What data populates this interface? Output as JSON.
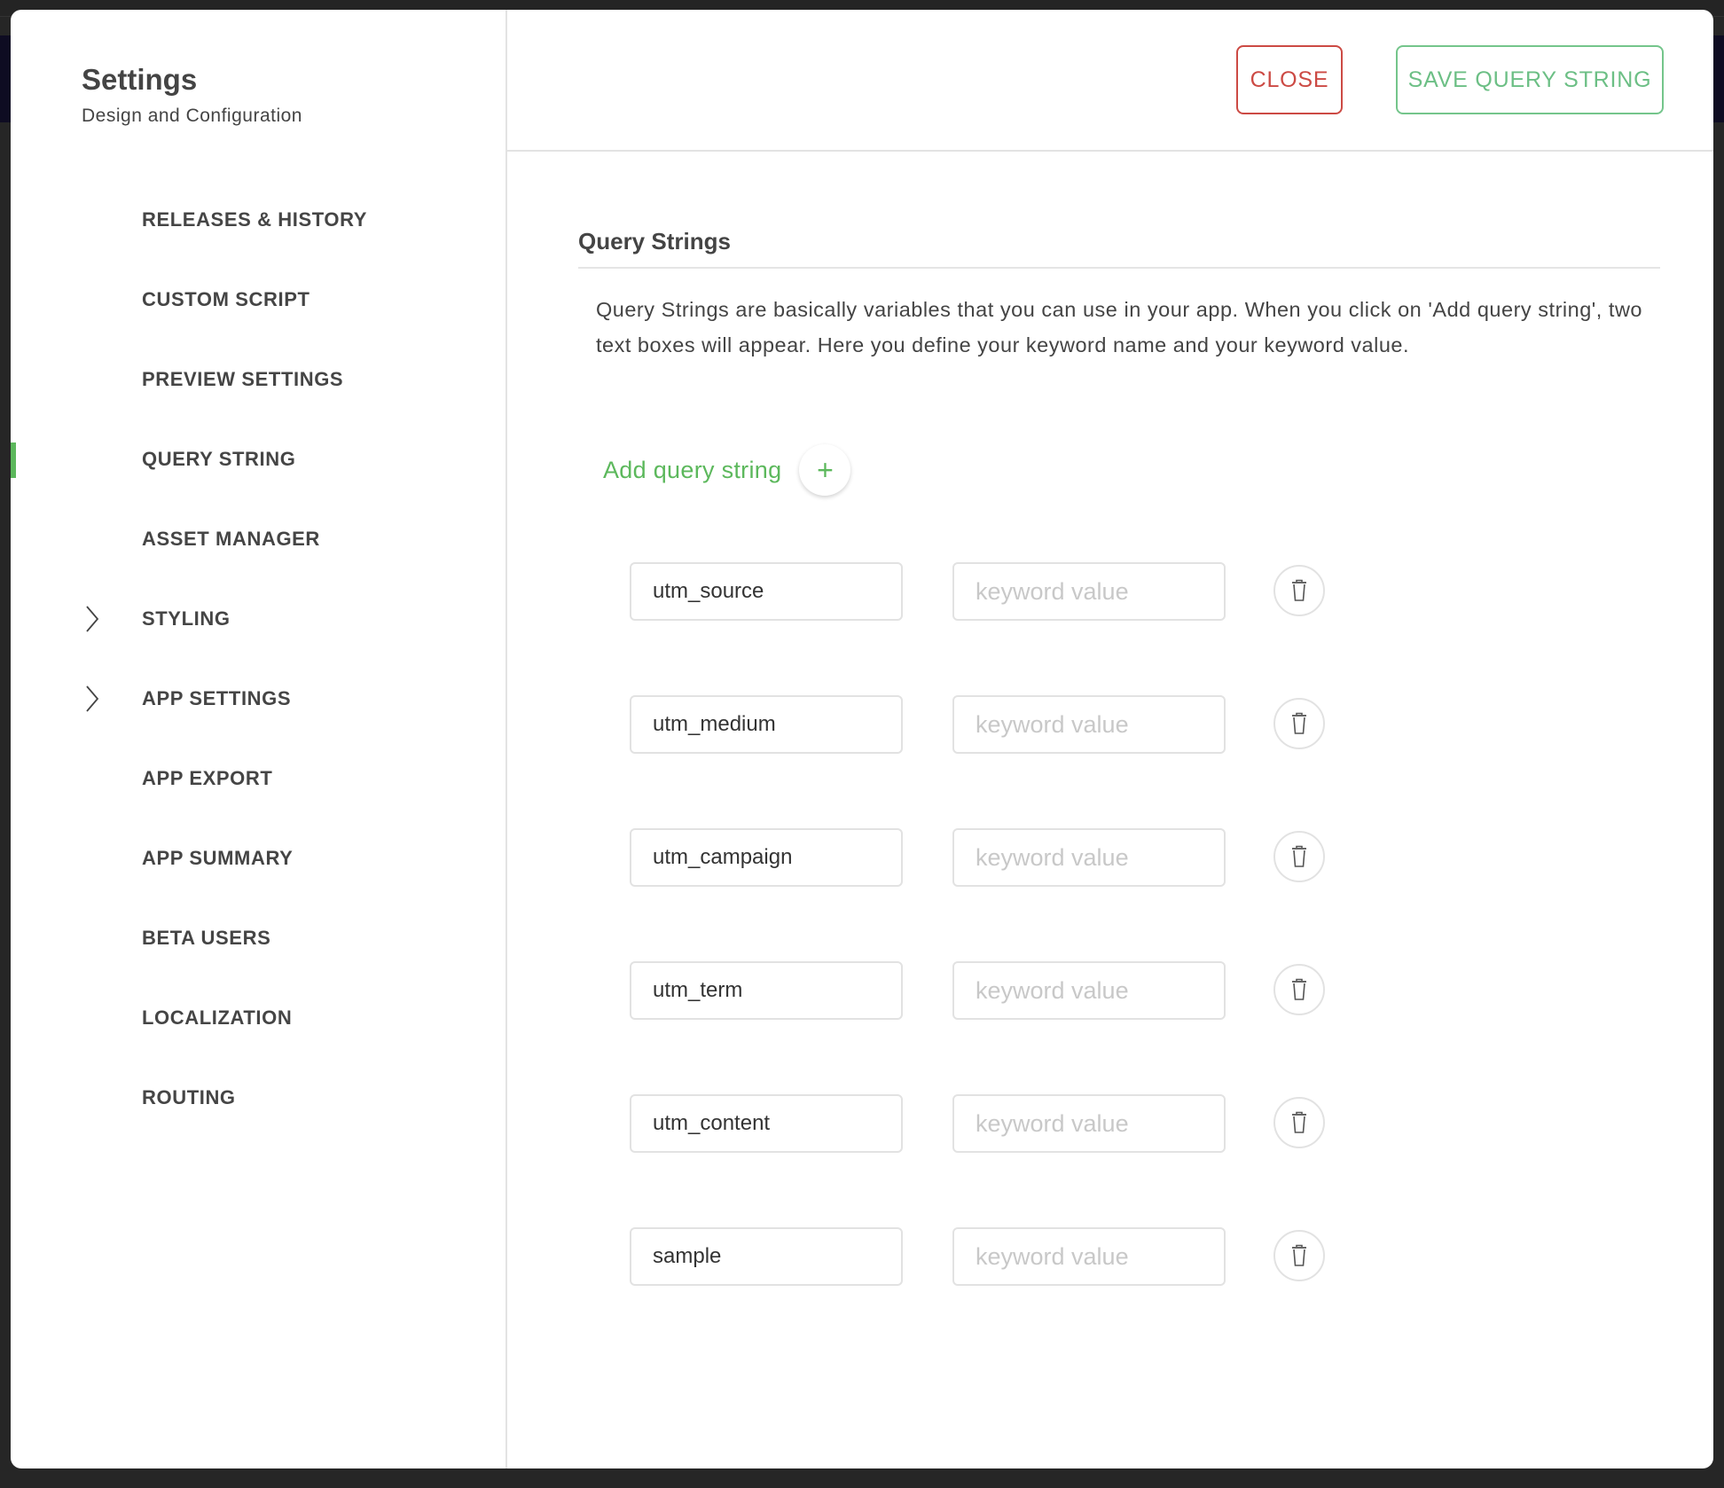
{
  "sidebar": {
    "title": "Settings",
    "subtitle": "Design and Configuration",
    "items": [
      {
        "label": "RELEASES & HISTORY",
        "expandable": false,
        "active": false
      },
      {
        "label": "CUSTOM SCRIPT",
        "expandable": false,
        "active": false
      },
      {
        "label": "PREVIEW SETTINGS",
        "expandable": false,
        "active": false
      },
      {
        "label": "QUERY STRING",
        "expandable": false,
        "active": true
      },
      {
        "label": "ASSET MANAGER",
        "expandable": false,
        "active": false
      },
      {
        "label": "STYLING",
        "expandable": true,
        "active": false
      },
      {
        "label": "APP SETTINGS",
        "expandable": true,
        "active": false
      },
      {
        "label": "APP EXPORT",
        "expandable": false,
        "active": false
      },
      {
        "label": "APP SUMMARY",
        "expandable": false,
        "active": false
      },
      {
        "label": "BETA USERS",
        "expandable": false,
        "active": false
      },
      {
        "label": "LOCALIZATION",
        "expandable": false,
        "active": false
      },
      {
        "label": "ROUTING",
        "expandable": false,
        "active": false
      }
    ]
  },
  "header": {
    "close_label": "CLOSE",
    "save_label": "SAVE QUERY STRING"
  },
  "section": {
    "title": "Query Strings",
    "description": "Query Strings are basically variables that you can use in your app. When you click on 'Add query string', two text boxes will appear. Here you define your keyword name and your keyword value.",
    "add_label": "Add query string",
    "add_icon": "plus-icon"
  },
  "query_strings": [
    {
      "name": "utm_source",
      "value": "",
      "value_placeholder": "keyword value"
    },
    {
      "name": "utm_medium",
      "value": "",
      "value_placeholder": "keyword value"
    },
    {
      "name": "utm_campaign",
      "value": "",
      "value_placeholder": "keyword value"
    },
    {
      "name": "utm_term",
      "value": "",
      "value_placeholder": "keyword value"
    },
    {
      "name": "utm_content",
      "value": "",
      "value_placeholder": "keyword value"
    },
    {
      "name": "sample",
      "value": "",
      "value_placeholder": "keyword value"
    }
  ],
  "colors": {
    "accent_green": "#5cb85c",
    "close_red": "#cc4a44",
    "save_green": "#6cbf85"
  }
}
